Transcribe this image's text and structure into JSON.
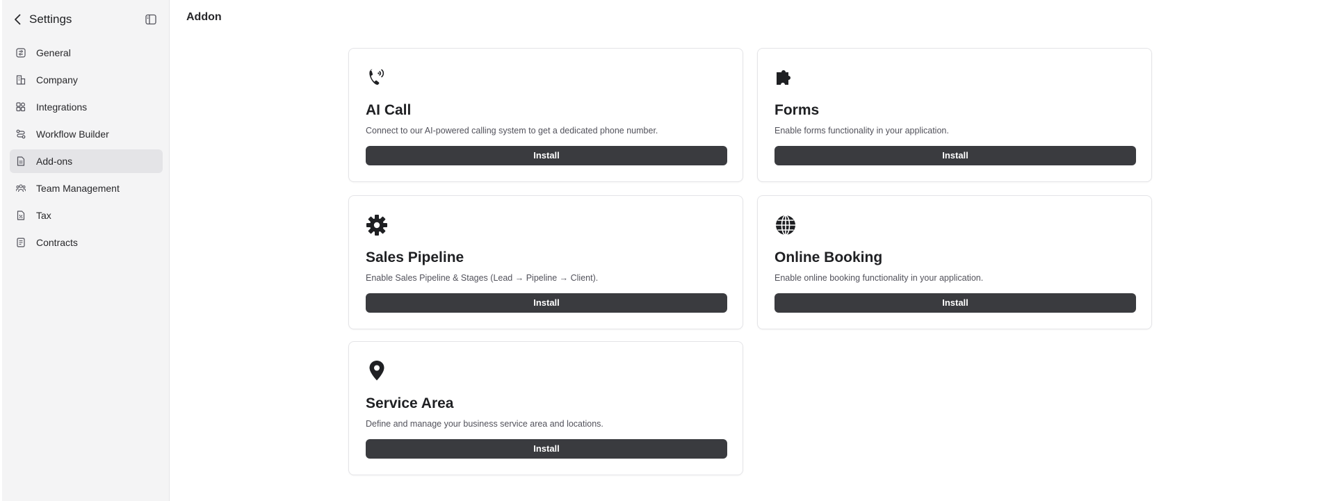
{
  "sidebar": {
    "title": "Settings",
    "items": [
      {
        "label": "General",
        "icon": "general-icon",
        "active": false
      },
      {
        "label": "Company",
        "icon": "company-icon",
        "active": false
      },
      {
        "label": "Integrations",
        "icon": "integrations-icon",
        "active": false
      },
      {
        "label": "Workflow Builder",
        "icon": "workflow-icon",
        "active": false
      },
      {
        "label": "Add-ons",
        "icon": "addons-icon",
        "active": true
      },
      {
        "label": "Team Management",
        "icon": "team-icon",
        "active": false
      },
      {
        "label": "Tax",
        "icon": "tax-icon",
        "active": false
      },
      {
        "label": "Contracts",
        "icon": "contracts-icon",
        "active": false
      }
    ]
  },
  "main": {
    "title": "Addon",
    "cards": [
      {
        "title": "AI Call",
        "description": "Connect to our AI-powered calling system to get a dedicated phone number.",
        "button": "Install",
        "icon": "phone-call-icon"
      },
      {
        "title": "Forms",
        "description": "Enable forms functionality in your application.",
        "button": "Install",
        "icon": "puzzle-icon"
      },
      {
        "title": "Sales Pipeline",
        "description": "Enable Sales Pipeline & Stages (Lead → Pipeline → Client).",
        "button": "Install",
        "icon": "gear-icon"
      },
      {
        "title": "Online Booking",
        "description": "Enable online booking functionality in your application.",
        "button": "Install",
        "icon": "globe-icon"
      },
      {
        "title": "Service Area",
        "description": "Define and manage your business service area and locations.",
        "button": "Install",
        "icon": "map-pin-icon"
      }
    ]
  },
  "colors": {
    "sidebar_bg": "#f4f4f5",
    "active_item_bg": "#e4e4e7",
    "button_bg": "#3a3b3f",
    "border": "#e4e4e7"
  }
}
